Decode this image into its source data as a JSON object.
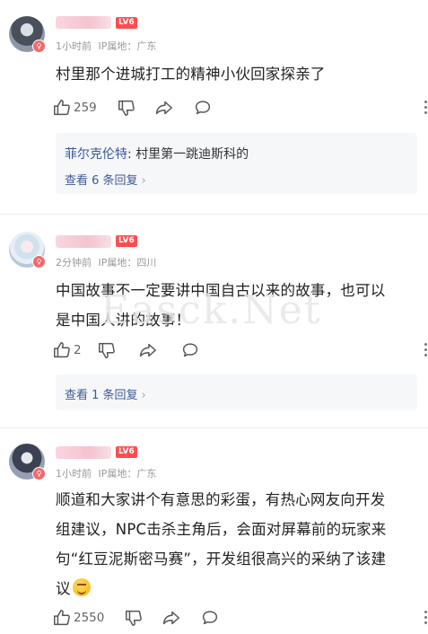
{
  "comments": [
    {
      "level": "LV6",
      "time": "1小时前",
      "ip_label": "IP属地：",
      "ip_location": "广东",
      "text_lines": [
        "村里那个进城打工的精神小伙回家探亲了"
      ],
      "likes": "259",
      "reply_preview": {
        "author": "菲尔克伦特",
        "separator": ": ",
        "text": "村里第一跳迪斯科的"
      },
      "view_replies": "查看 6 条回复"
    },
    {
      "level": "LV6",
      "time": "2分钟前",
      "ip_label": "IP属地：",
      "ip_location": "四川",
      "text_lines": [
        "中国故事不一定要讲中国自古以来的故事，也可以",
        "是中国人讲的故事！"
      ],
      "likes": "2",
      "view_replies": "查看 1 条回复"
    },
    {
      "level": "LV6",
      "time": "1小时前",
      "ip_label": "IP属地：",
      "ip_location": "广东",
      "text_lines": [
        "顺道和大家讲个有意思的彩蛋，有热心网友向开发",
        "组建议，NPC击杀主角后，会面对屏幕前的玩家来",
        "句“红豆泥斯密马赛”，开发组很高兴的采纳了该建",
        "议"
      ],
      "likes": "2550"
    }
  ],
  "watermark": "Easck.Net",
  "icons": [
    "like-icon",
    "dislike-icon",
    "share-icon",
    "comment-icon",
    "more-icon",
    "smirk-emoji-icon"
  ]
}
